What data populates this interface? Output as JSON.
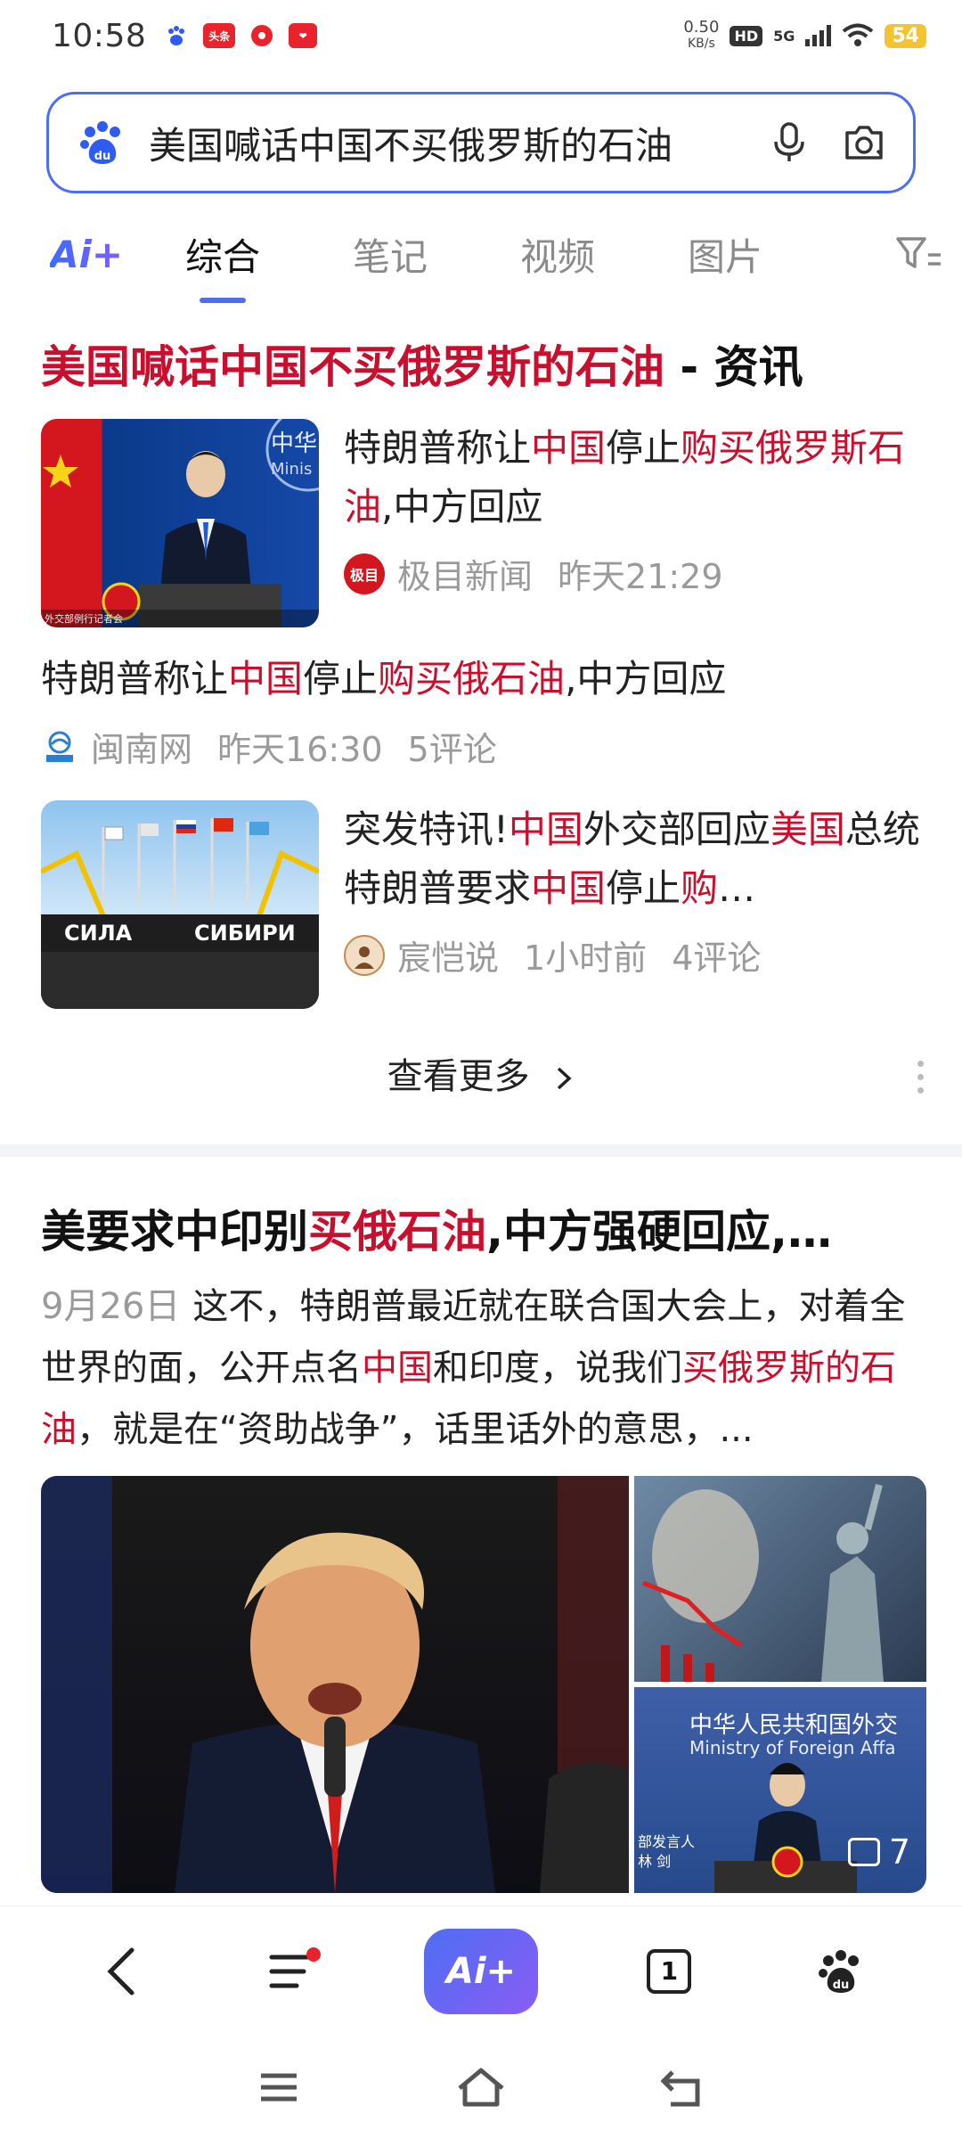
{
  "status_bar": {
    "time": "10:58",
    "net_speed_value": "0.50",
    "net_speed_unit": "KB/s",
    "hd_label": "HD",
    "network_label": "5G",
    "battery": "54",
    "app_icons": [
      "baidu-icon",
      "toutiao-icon",
      "music-icon",
      "app-icon"
    ]
  },
  "search": {
    "query": "美国喊话中国不买俄罗斯的石油"
  },
  "tabs": {
    "ai_label": "Ai+",
    "items": [
      {
        "label": "综合",
        "active": true
      },
      {
        "label": "笔记",
        "active": false
      },
      {
        "label": "视频",
        "active": false
      },
      {
        "label": "图片",
        "active": false
      }
    ]
  },
  "result1": {
    "title_highlight": "美国喊话中国不买俄罗斯的石油",
    "title_suffix": " - 资讯",
    "item1": {
      "title_parts": [
        "特朗普称让",
        "中国",
        "停止",
        "购买俄罗斯石油",
        ",中方回应"
      ],
      "source_icon_text": "极目",
      "source": "极目新闻",
      "time": "昨天21:29",
      "thumb_caption": "外交部例行记者会"
    },
    "item2": {
      "title_parts": [
        "特朗普称让",
        "中国",
        "停止",
        "购买俄石油",
        ",中方回应"
      ],
      "source": "闽南网",
      "time": "昨天16:30",
      "comments": "5评论"
    },
    "item3": {
      "title_parts": [
        "突发特讯!",
        "中国",
        "外交部回应",
        "美国",
        "总统特朗普要求",
        "中国",
        "停止",
        "购",
        "…"
      ],
      "source": "宸恺说",
      "time": "1小时前",
      "comments": "4评论",
      "thumb_text_left": "СИЛА",
      "thumb_text_right": "СИБИРИ"
    },
    "more_label": "查看更多"
  },
  "result2": {
    "title_parts": [
      "美要求中印别",
      "买俄石油",
      ",中方强硬回应,…"
    ],
    "date": "9月26日",
    "snippet_parts": [
      "这不，特朗普最近就在联合国大会上，对着全世界的面，公开点名",
      "中国",
      "和印度，说我们",
      "买俄罗斯的石油",
      "，就是在“资助战争”，话里话外的意思，..."
    ],
    "image_count": "7",
    "side_bottom_sign_cn": "中华人民共和国外交",
    "side_bottom_sign_en": "Ministry of Foreign Affa",
    "side_bottom_label1": "部发言人",
    "side_bottom_label2": "林 剑"
  },
  "bottom_bar": {
    "ai_label": "Ai+",
    "tab_count": "1"
  },
  "colors": {
    "accent": "#4e6ef2",
    "highlight": "#c8102e",
    "meta_gray": "#9a9a9a"
  }
}
